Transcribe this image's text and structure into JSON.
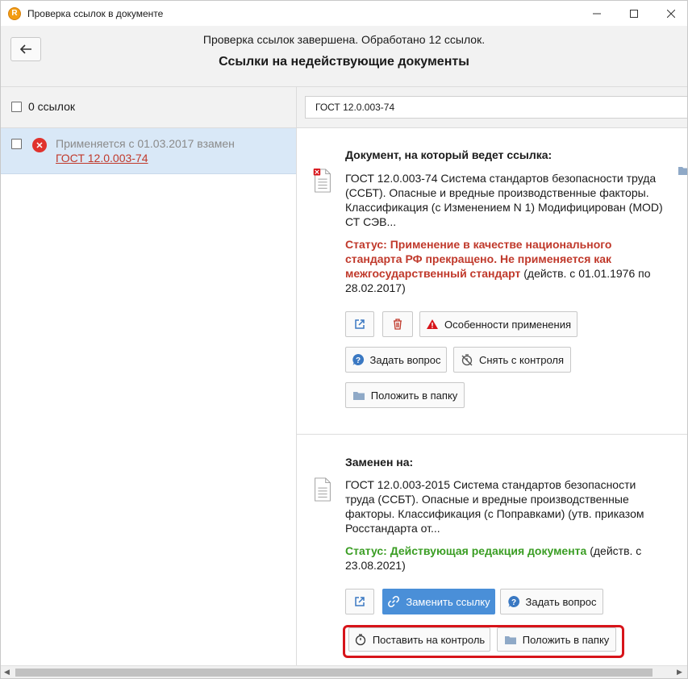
{
  "window": {
    "title": "Проверка ссылок в документе",
    "app_icon_letter": "R",
    "minimize_glyph": "—",
    "maximize_glyph": "☐",
    "close_glyph": "✕"
  },
  "header": {
    "status": "Проверка ссылок завершена. Обработано 12 ссылок.",
    "title": "Ссылки на недействующие документы"
  },
  "left": {
    "select_all_label": "0 ссылок",
    "items": [
      {
        "status_text": "Применяется с 01.03.2017 взамен",
        "link_text": "ГОСТ 12.0.003-74",
        "icon": "error-x-icon"
      }
    ]
  },
  "right": {
    "search_value": "ГОСТ 12.0.003-74",
    "target_doc": {
      "section_title": "Документ, на который ведет ссылка:",
      "description": "ГОСТ 12.0.003-74 Система стандартов безопасности труда (ССБТ). Опасные и вредные производственные факторы. Классификация (с Изменением N 1) Модифицирован (MOD) СТ СЭВ...",
      "status_label": "Статус: Применение в качестве национального стандарта РФ прекращено. Не применяется как межгосударственный стандарт",
      "status_tail": " (действ. с 01.01.1976 по 28.02.2017)",
      "buttons": {
        "features": "Особенности применения",
        "ask_question": "Задать вопрос",
        "remove_control": "Снять с контроля",
        "put_in_folder": "Положить в папку"
      }
    },
    "replacement_doc": {
      "section_title": "Заменен на:",
      "description": "ГОСТ 12.0.003-2015 Система стандартов безопасности труда (ССБТ). Опасные и вредные производственные факторы. Классификация (с Поправками) (утв. приказом Росстандарта от...",
      "status_label": "Статус: Действующая редакция документа",
      "status_tail": " (действ. с 23.08.2021)",
      "buttons": {
        "replace_link": "Заменить ссылку",
        "ask_question": "Задать вопрос",
        "put_on_control": "Поставить на контроль",
        "put_in_folder": "Положить в папку"
      }
    }
  },
  "colors": {
    "status_red": "#c0392b",
    "status_green": "#3a9d23",
    "primary": "#4a8fd8",
    "highlight": "#d7141a",
    "selected_row": "#d9e8f7"
  }
}
